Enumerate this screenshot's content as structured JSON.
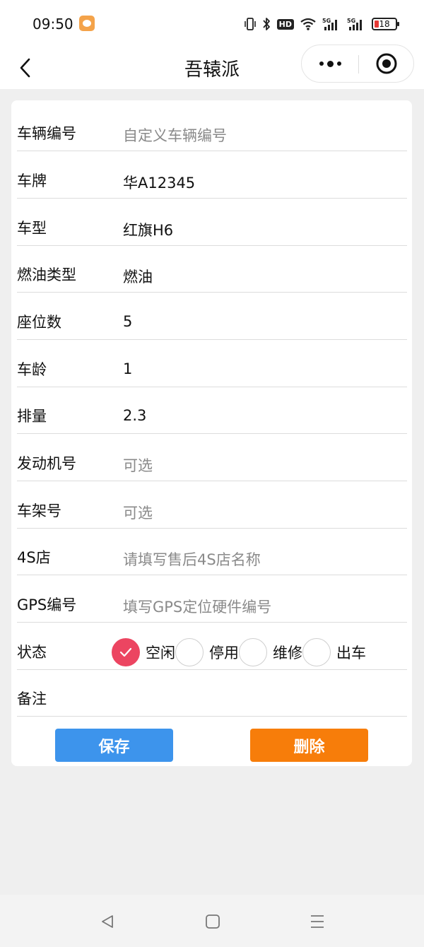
{
  "status_bar": {
    "time": "09:50",
    "hd_label": "HD",
    "signal_label": "5G",
    "battery_level": "18"
  },
  "nav": {
    "title": "吾辕派",
    "back_icon": "chevron-left-icon",
    "more_icon": "more-dots-icon",
    "close_icon": "target-circle-icon"
  },
  "form": {
    "fields": [
      {
        "label": "车辆编号",
        "value": "",
        "placeholder": "自定义车辆编号"
      },
      {
        "label": "车牌",
        "value": "华A12345",
        "placeholder": ""
      },
      {
        "label": "车型",
        "value": "红旗H6",
        "placeholder": ""
      },
      {
        "label": "燃油类型",
        "value": "燃油",
        "placeholder": ""
      },
      {
        "label": "座位数",
        "value": "5",
        "placeholder": ""
      },
      {
        "label": "车龄",
        "value": "1",
        "placeholder": ""
      },
      {
        "label": "排量",
        "value": "2.3",
        "placeholder": ""
      },
      {
        "label": "发动机号",
        "value": "",
        "placeholder": "可选"
      },
      {
        "label": "车架号",
        "value": "",
        "placeholder": "可选"
      },
      {
        "label": "4S店",
        "value": "",
        "placeholder": "请填写售后4S店名称"
      },
      {
        "label": "GPS编号",
        "value": "",
        "placeholder": "填写GPS定位硬件编号"
      }
    ],
    "status": {
      "label": "状态",
      "options": [
        "空闲",
        "停用",
        "维修",
        "出车"
      ],
      "selected": "空闲"
    },
    "remark": {
      "label": "备注",
      "value": ""
    }
  },
  "buttons": {
    "save": "保存",
    "delete": "删除"
  },
  "colors": {
    "accent_selected": "#ec4561",
    "save_button": "#3d94ec",
    "delete_button": "#f77d0a"
  }
}
